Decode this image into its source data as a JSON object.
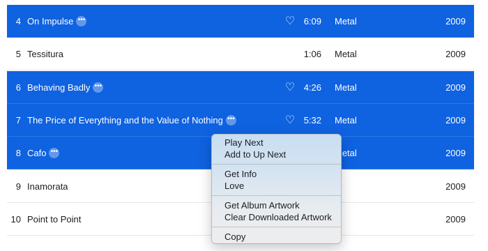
{
  "tracks": [
    {
      "num": "4",
      "title": "On Impulse",
      "time": "6:09",
      "genre": "Metal",
      "year": "2009",
      "selected": true,
      "hearted": true
    },
    {
      "num": "5",
      "title": "Tessitura",
      "time": "1:06",
      "genre": "Metal",
      "year": "2009",
      "selected": false,
      "hearted": false
    },
    {
      "num": "6",
      "title": "Behaving Badly",
      "time": "4:26",
      "genre": "Metal",
      "year": "2009",
      "selected": true,
      "hearted": true
    },
    {
      "num": "7",
      "title": "The Price of Everything and the Value of Nothing",
      "time": "5:32",
      "genre": "Metal",
      "year": "2009",
      "selected": true,
      "hearted": true
    },
    {
      "num": "8",
      "title": "Cafo",
      "time": "",
      "genre": "Metal",
      "year": "2009",
      "selected": true,
      "hearted": false
    },
    {
      "num": "9",
      "title": "Inamorata",
      "time": "",
      "genre": "",
      "year": "2009",
      "selected": false,
      "hearted": false
    },
    {
      "num": "10",
      "title": "Point to Point",
      "time": "",
      "genre": "",
      "year": "2009",
      "selected": false,
      "hearted": false
    }
  ],
  "more_glyph": "•••",
  "heart_glyph": "♡",
  "context_menu": {
    "groups": [
      [
        "Play Next",
        "Add to Up Next"
      ],
      [
        "Get Info",
        "Love"
      ],
      [
        "Get Album Artwork",
        "Clear Downloaded Artwork"
      ],
      [
        "Copy"
      ]
    ]
  },
  "colors": {
    "selection": "#0f62e0",
    "menu_top": "#c8def2",
    "menu_bottom": "#ededed"
  }
}
